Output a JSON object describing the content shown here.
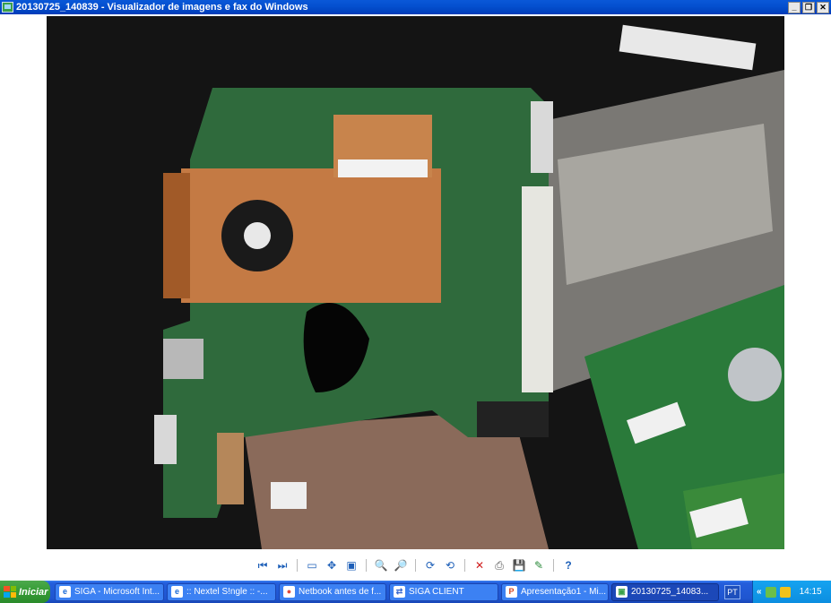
{
  "window": {
    "title": "20130725_140839 - Visualizador de imagens e fax do Windows",
    "minimize_label": "_",
    "restore_label": "❐",
    "close_label": "✕"
  },
  "toolbar": {
    "buttons": [
      {
        "name": "previous-image-button",
        "glyph": "⏮"
      },
      {
        "name": "next-image-button",
        "glyph": "⏭"
      },
      {
        "name": "best-fit-button",
        "glyph": "▭"
      },
      {
        "name": "actual-size-button",
        "glyph": "✥"
      },
      {
        "name": "slideshow-button",
        "glyph": "▣"
      },
      {
        "name": "zoom-in-button",
        "glyph": "🔍"
      },
      {
        "name": "zoom-out-button",
        "glyph": "🔎"
      },
      {
        "name": "rotate-clockwise-button",
        "glyph": "⟳"
      },
      {
        "name": "rotate-counterclockwise-button",
        "glyph": "⟲"
      },
      {
        "name": "delete-button",
        "glyph": "✕"
      },
      {
        "name": "print-button",
        "glyph": "⎙"
      },
      {
        "name": "save-button",
        "glyph": "💾"
      },
      {
        "name": "open-for-editing-button",
        "glyph": "✎"
      },
      {
        "name": "help-button",
        "glyph": "?"
      }
    ]
  },
  "taskbar": {
    "start_label": "Iniciar",
    "tasks": [
      {
        "label": "SIGA - Microsoft Int...",
        "icon": "ie-icon",
        "color": "#1a6ad8",
        "glyph": "e"
      },
      {
        "label": ":: Nextel S!ngle :: -...",
        "icon": "ie-icon",
        "color": "#1a6ad8",
        "glyph": "e"
      },
      {
        "label": "Netbook antes de f...",
        "icon": "chrome-icon",
        "color": "#e04a3a",
        "glyph": "●"
      },
      {
        "label": "SIGA CLIENT",
        "icon": "arrows-icon",
        "color": "#3a6ad0",
        "glyph": "⇄"
      },
      {
        "label": "Apresentação1 - Mi...",
        "icon": "powerpoint-icon",
        "color": "#d24726",
        "glyph": "P"
      },
      {
        "label": "20130725_14083...",
        "icon": "image-viewer-icon",
        "color": "#3aa04a",
        "glyph": "▣",
        "active": true
      }
    ],
    "language": "PT",
    "tray_expand": "«",
    "clock": "14:15"
  }
}
